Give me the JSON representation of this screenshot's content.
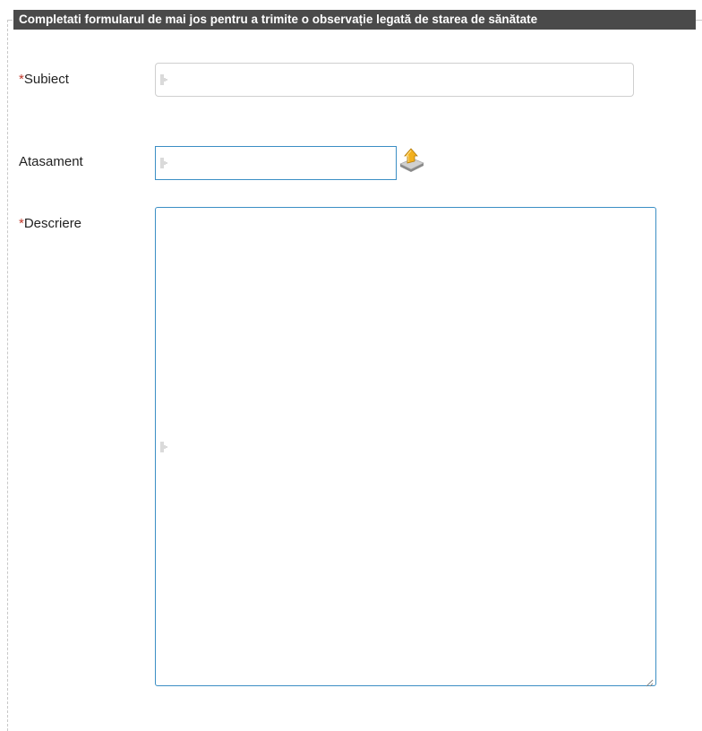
{
  "form": {
    "legend": "Completati formularul de mai jos pentru a trimite o observație legată de starea de sănătate",
    "required_marker": "*",
    "fields": {
      "subiect": {
        "label": "Subiect",
        "required": true,
        "value": ""
      },
      "atasament": {
        "label": "Atasament",
        "required": false,
        "value": ""
      },
      "descriere": {
        "label": "Descriere",
        "required": true,
        "value": ""
      }
    }
  },
  "icons": {
    "upload": "upload-icon",
    "caret": "text-cursor-icon",
    "resize": "resize-grip-icon"
  },
  "colors": {
    "legend_bg": "#4a4a4a",
    "required": "#c0392b",
    "focus_border": "#3b8ec4"
  }
}
